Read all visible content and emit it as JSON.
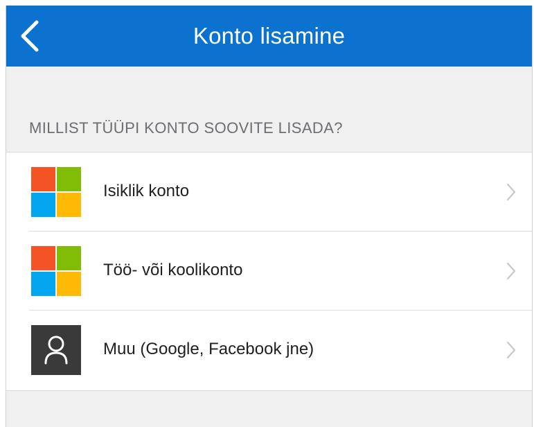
{
  "header": {
    "back_icon": "chevron-left-icon",
    "title": "Konto lisamine",
    "background_color": "#0b72d0"
  },
  "section": {
    "heading": "MILLIST TÜÜPI KONTO SOOVITE LISADA?"
  },
  "account_options": [
    {
      "label": "Isiklik konto",
      "icon": "microsoft-logo-icon"
    },
    {
      "label": "Töö- või koolikonto",
      "icon": "microsoft-logo-icon"
    },
    {
      "label": "Muu (Google, Facebook jne)",
      "icon": "person-icon"
    }
  ],
  "colors": {
    "ms_red": "#f35325",
    "ms_green": "#81bc06",
    "ms_blue": "#05a6f0",
    "ms_yellow": "#ffba08",
    "person_tile": "#3a3a3a"
  }
}
